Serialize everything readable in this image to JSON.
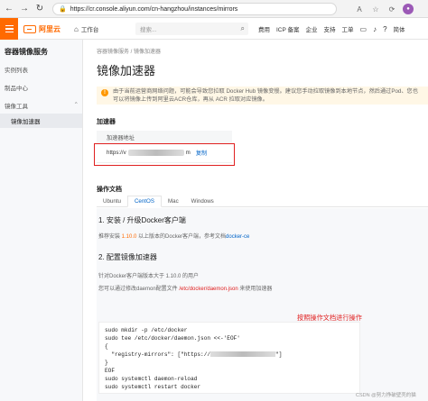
{
  "browser": {
    "url": "https://cr.console.aliyun.com/cn-hangzhou/instances/mirrors"
  },
  "topbar": {
    "logo_text": "阿里云",
    "workspace": "工作台",
    "search_placeholder": "搜索...",
    "nav": [
      "费用",
      "ICP 备案",
      "企业",
      "支持",
      "工单",
      "简体"
    ]
  },
  "sidebar": {
    "title": "容器镜像服务",
    "items": [
      "实例列表",
      "制品中心",
      "镜像工具",
      "镜像加速器"
    ]
  },
  "main": {
    "breadcrumb": "容器镜像服务 / 镜像加速器",
    "page_title": "镜像加速器",
    "notice": "由于当前运营商网络问题，可能会导致您拉取 Docker Hub 镜像变慢。建议您手动拉取镜像到本地节点，然后通过Pod、您也可以将镜像上传到阿里云ACR仓库，再从 ACR 拉取对应镜像。",
    "accelerator_section": "加速器",
    "table_header": "加速器地址",
    "address_prefix": "https://v",
    "address_suffix": "m",
    "copy_label": "复制",
    "ops_section": "操作文档",
    "tabs": [
      "Ubuntu",
      "CentOS",
      "Mac",
      "Windows"
    ],
    "step1_title": "1. 安装 / 升级Docker客户端",
    "step1_text_a": "推荐安装 ",
    "step1_version": "1.10.0",
    "step1_text_b": " 以上版本的Docker客户端，参考文档",
    "step1_link": "docker-ce",
    "step2_title": "2. 配置镜像加速器",
    "step2_text1": "针对Docker客户端版本大于 1.10.0 的用户",
    "step2_text2_a": "您可以通过修改daemon配置文件 ",
    "step2_path": "/etc/docker/daemon.json",
    "step2_text2_b": " 来使用加速器",
    "annotation": "按照操作文档进行操作",
    "code_lines": [
      "sudo mkdir -p /etc/docker",
      "sudo tee /etc/docker/daemon.json <<-'EOF'",
      "{",
      "  \"registry-mirrors\": [\"https://",
      "}",
      "EOF",
      "sudo systemctl daemon-reload",
      "sudo systemctl restart docker"
    ],
    "code_line4_end": "\"]"
  },
  "watermark": "CSDN @努力挣破壁壳的猫"
}
